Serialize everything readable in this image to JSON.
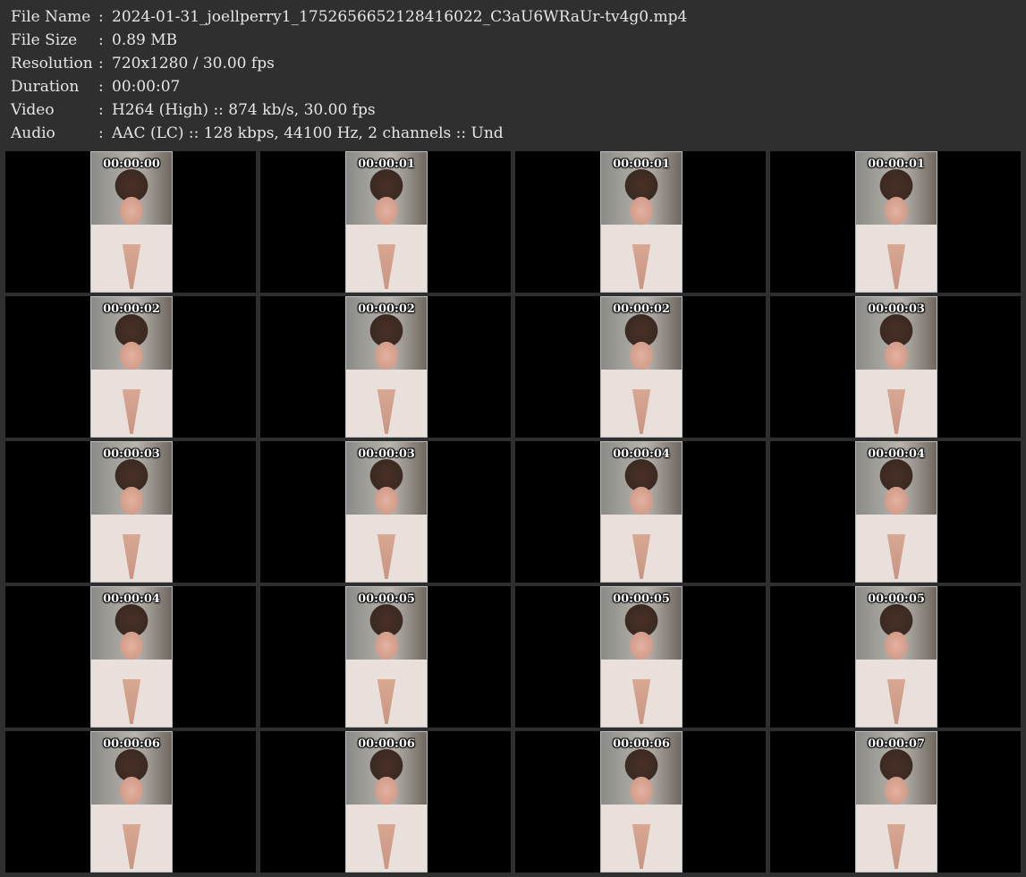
{
  "info": [
    {
      "label": "File Name",
      "sep": ":",
      "value": "2024-01-31_joellperry1_1752656652128416022_C3aU6WRaUr-tv4g0.mp4"
    },
    {
      "label": "File Size",
      "sep": ":",
      "value": "0.89 MB"
    },
    {
      "label": "Resolution",
      "sep": ":",
      "value": "720x1280 / 30.00 fps"
    },
    {
      "label": "Duration",
      "sep": ":",
      "value": "00:00:07"
    },
    {
      "label": "Video",
      "sep": ":",
      "value": "H264 (High) :: 874 kb/s, 30.00 fps"
    },
    {
      "label": "Audio",
      "sep": ":",
      "value": "AAC (LC) :: 128 kbps, 44100 Hz, 2 channels :: Und"
    }
  ],
  "thumbnails": [
    {
      "timestamp": "00:00:00"
    },
    {
      "timestamp": "00:00:01"
    },
    {
      "timestamp": "00:00:01"
    },
    {
      "timestamp": "00:00:01"
    },
    {
      "timestamp": "00:00:02"
    },
    {
      "timestamp": "00:00:02"
    },
    {
      "timestamp": "00:00:02"
    },
    {
      "timestamp": "00:00:03"
    },
    {
      "timestamp": "00:00:03"
    },
    {
      "timestamp": "00:00:03"
    },
    {
      "timestamp": "00:00:04"
    },
    {
      "timestamp": "00:00:04"
    },
    {
      "timestamp": "00:00:04"
    },
    {
      "timestamp": "00:00:05"
    },
    {
      "timestamp": "00:00:05"
    },
    {
      "timestamp": "00:00:05"
    },
    {
      "timestamp": "00:00:06"
    },
    {
      "timestamp": "00:00:06"
    },
    {
      "timestamp": "00:00:06"
    },
    {
      "timestamp": "00:00:07"
    }
  ]
}
